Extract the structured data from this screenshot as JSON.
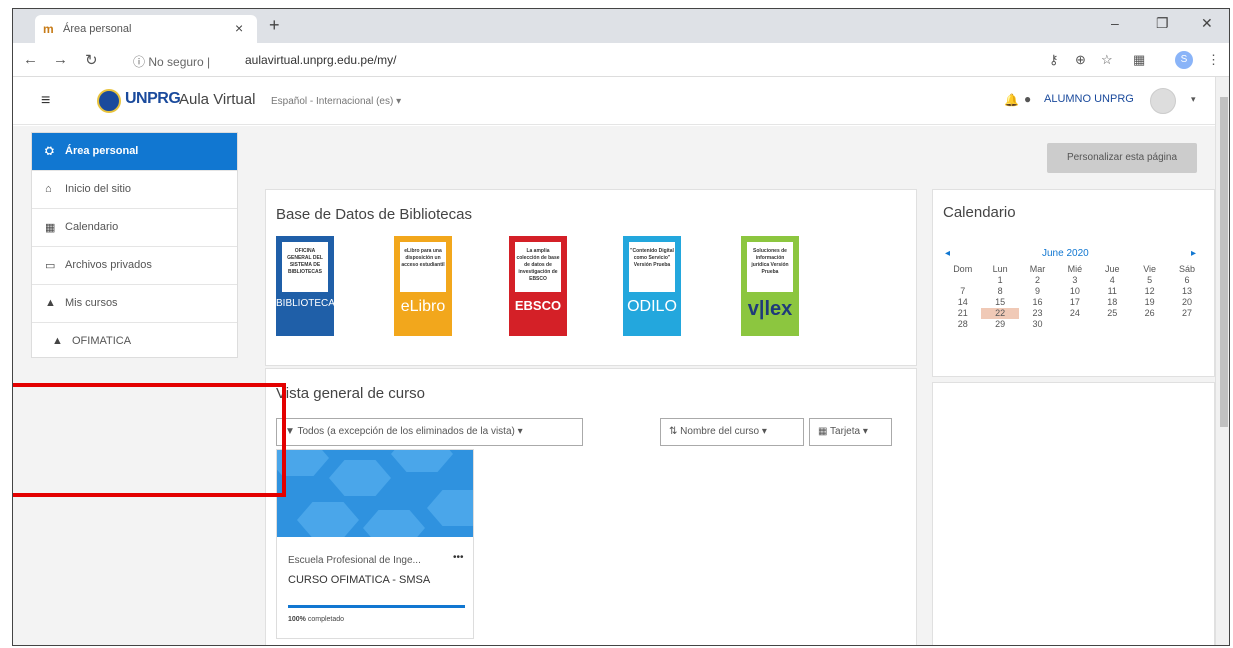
{
  "browser": {
    "tab_title": "Área personal",
    "tab_favicon": "moodle-icon",
    "security_label": "No seguro",
    "url": "aulavirtual.unprg.edu.pe/my/",
    "profile_initial": "S"
  },
  "header": {
    "brand": "UNPRG",
    "site_name": "Aula Virtual",
    "language": "Español - Internacional (es) ▾",
    "username": "ALUMNO UNPRG"
  },
  "sidebar": {
    "items": [
      {
        "label": "Área personal",
        "icon": "dashboard-icon",
        "glyph": "⛭"
      },
      {
        "label": "Inicio del sitio",
        "icon": "home-icon",
        "glyph": "⌂"
      },
      {
        "label": "Calendario",
        "icon": "calendar-icon",
        "glyph": "▦"
      },
      {
        "label": "Archivos privados",
        "icon": "file-icon",
        "glyph": "▭"
      },
      {
        "label": "Mis cursos",
        "icon": "graduation-cap-icon",
        "glyph": "▲"
      },
      {
        "label": "OFIMATICA",
        "icon": "graduation-cap-icon",
        "glyph": "▲"
      }
    ]
  },
  "customize_button": "Personalizar esta página",
  "library_block": {
    "title": "Base de Datos de Bibliotecas",
    "books": [
      {
        "name": "BIBLIOTECA",
        "text": "OFICINA GENERAL DEL SISTEMA DE BIBLIOTECAS",
        "color": "#1f5fa8"
      },
      {
        "name": "eLibro",
        "text": "eLibro para una disposición un acceso estudiantil",
        "color": "#f2a71c"
      },
      {
        "name": "EBSCO",
        "text": "La amplia colección de base de datos de investigación de EBSCO",
        "color": "#d42027"
      },
      {
        "name": "ODILO",
        "text": "\"Contenido Digital como Servicio\" Versión Prueba",
        "color": "#23a7dd"
      },
      {
        "name": "v|lex",
        "text": "Soluciones de información jurídica Versión Prueba",
        "color": "#8cc63f"
      }
    ]
  },
  "course_overview": {
    "title": "Vista general de curso",
    "filter_label": "Todos (a excepción de los eliminados de la vista) ▾",
    "sort_label": "Nombre del curso ▾",
    "view_label": "Tarjeta ▾",
    "course": {
      "category": "Escuela Profesional de Inge...",
      "name": "CURSO OFIMATICA - SMSA",
      "progress_value": "100%",
      "progress_text": "completado"
    }
  },
  "calendar": {
    "title": "Calendario",
    "month": "June 2020",
    "prev": "◂",
    "next": "▸",
    "weekdays": [
      "Dom",
      "Lun",
      "Mar",
      "Mié",
      "Jue",
      "Vie",
      "Sáb"
    ],
    "weeks": [
      [
        "",
        "1",
        "2",
        "3",
        "4",
        "5",
        "6"
      ],
      [
        "7",
        "8",
        "9",
        "10",
        "11",
        "12",
        "13"
      ],
      [
        "14",
        "15",
        "16",
        "17",
        "18",
        "19",
        "20"
      ],
      [
        "21",
        "22",
        "23",
        "24",
        "25",
        "26",
        "27"
      ],
      [
        "28",
        "29",
        "30",
        "",
        "",
        "",
        ""
      ]
    ],
    "today": "22"
  },
  "colors": {
    "primary": "#1177d1",
    "annotation_red": "#e30000"
  }
}
